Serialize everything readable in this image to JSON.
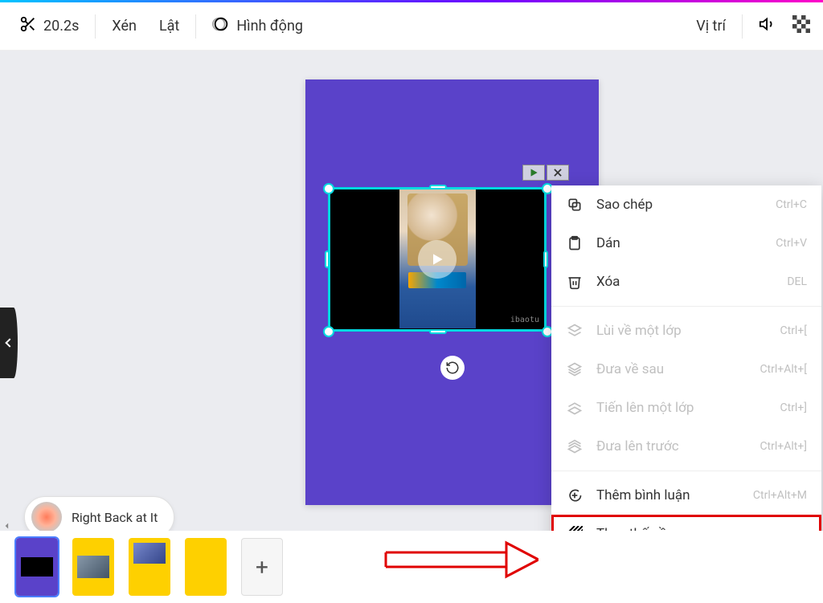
{
  "toolbar": {
    "duration": "20.2s",
    "crop": "Xén",
    "flip": "Lật",
    "animation": "Hình động",
    "position": "Vị trí"
  },
  "context_menu": {
    "copy": {
      "label": "Sao chép",
      "shortcut": "Ctrl+C"
    },
    "paste": {
      "label": "Dán",
      "shortcut": "Ctrl+V"
    },
    "delete": {
      "label": "Xóa",
      "shortcut": "DEL"
    },
    "back_layer": {
      "label": "Lùi về một lớp",
      "shortcut": "Ctrl+["
    },
    "send_back": {
      "label": "Đưa về sau",
      "shortcut": "Ctrl+Alt+["
    },
    "fwd_layer": {
      "label": "Tiến lên một lớp",
      "shortcut": "Ctrl+]"
    },
    "bring_front": {
      "label": "Đưa lên trước",
      "shortcut": "Ctrl+Alt+]"
    },
    "comment": {
      "label": "Thêm bình luận",
      "shortcut": "Ctrl+Alt+M"
    },
    "replace_bg": {
      "label": "Thay thế nền"
    }
  },
  "audio": {
    "title": "Right Back at It"
  },
  "watermark": "ibaotu",
  "thumbs": {
    "add": "+"
  }
}
